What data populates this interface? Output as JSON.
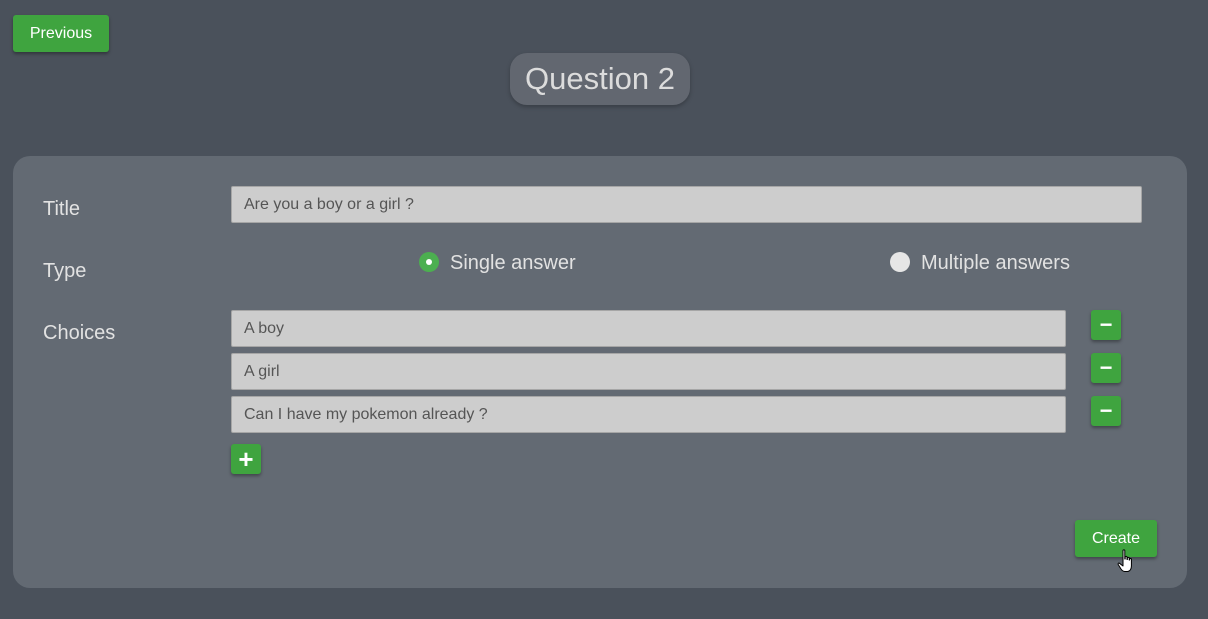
{
  "nav": {
    "previous_label": "Previous"
  },
  "question": {
    "heading": "Question 2"
  },
  "form": {
    "title_label": "Title",
    "title_value": "Are you a boy or a girl ?",
    "type_label": "Type",
    "type_options": [
      {
        "label": "Single answer",
        "selected": true
      },
      {
        "label": "Multiple answers",
        "selected": false
      }
    ],
    "choices_label": "Choices",
    "choices": [
      {
        "value": "A boy",
        "remove_label": "−"
      },
      {
        "value": "A girl",
        "remove_label": "−"
      },
      {
        "value": "Can I have my pokemon already ?",
        "remove_label": "−"
      }
    ],
    "add_choice_label": "+",
    "create_label": "Create"
  },
  "colors": {
    "background": "#4a515b",
    "panel": "#636a73",
    "accent_green": "#3fa43f",
    "input_bg": "#cdcdcd"
  }
}
